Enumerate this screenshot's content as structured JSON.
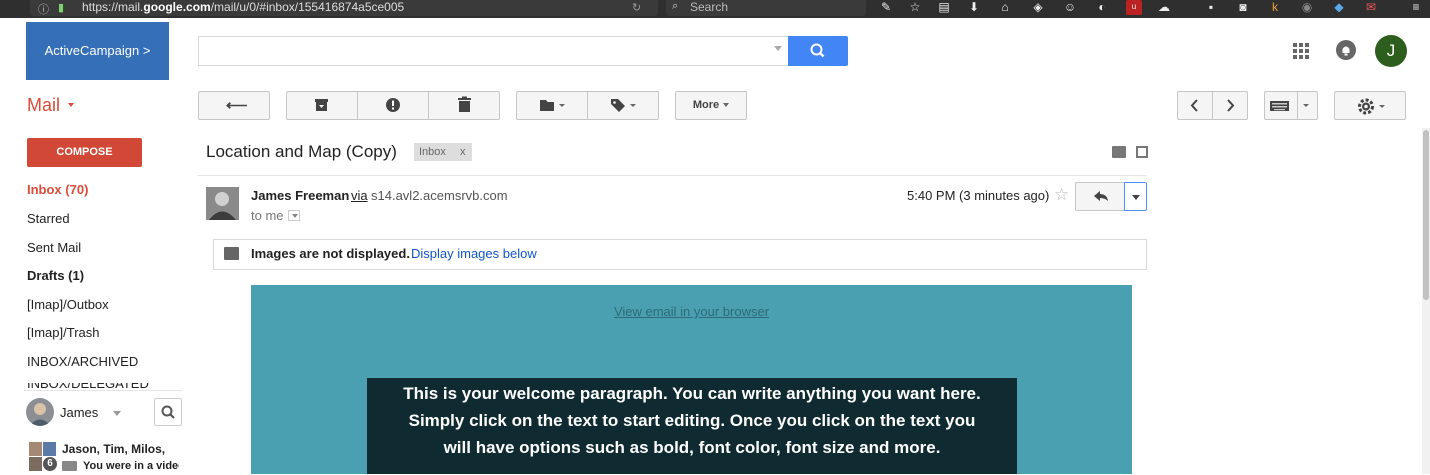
{
  "browser": {
    "url_prefix": "https://mail.",
    "url_domain": "google.com",
    "url_path": "/mail/u/0/#inbox/155416874a5ce005",
    "search_placeholder": "Search"
  },
  "header": {
    "logo_text": "ActiveCampaign >",
    "search_value": "",
    "avatar_initial": "J"
  },
  "toolbar": {
    "mail_label": "Mail",
    "more_label": "More"
  },
  "sidebar": {
    "compose_label": "COMPOSE",
    "items": [
      {
        "label": "Inbox (70)"
      },
      {
        "label": "Starred"
      },
      {
        "label": "Sent Mail"
      },
      {
        "label": "Drafts (1)"
      },
      {
        "label": "[Imap]/Outbox"
      },
      {
        "label": "[Imap]/Trash"
      },
      {
        "label": "INBOX/ARCHIVED"
      },
      {
        "label": "INBOX/DELEGATED"
      }
    ]
  },
  "hangouts": {
    "user_name": "James",
    "conversation_names": "Jason, Tim, Milos,",
    "conversation_snippet": "You were in a video",
    "participant_count": "6"
  },
  "message": {
    "subject": "Location and Map (Copy)",
    "label_tag": "Inbox",
    "label_remove": "x",
    "sender_name": "James Freeman",
    "via": "via",
    "sender_domain": "s14.avl2.acemsrvb.com",
    "to": "to me",
    "time": "5:40 PM (3 minutes ago)",
    "images_notice_bold": "Images are not displayed.",
    "images_notice_link": "Display images below"
  },
  "email_content": {
    "view_in_browser": "View email in your browser",
    "welcome_paragraph": "This is your welcome paragraph. You can write anything you want here. Simply click on the text to start editing. Once you click on the text you will have options such as bold, font color, font size and more."
  },
  "colors": {
    "compose": "#d14836",
    "search_button": "#4285f4",
    "logo": "#356fb7",
    "email_background": "#4aa0b0",
    "welcome_box": "#0f2a30"
  }
}
